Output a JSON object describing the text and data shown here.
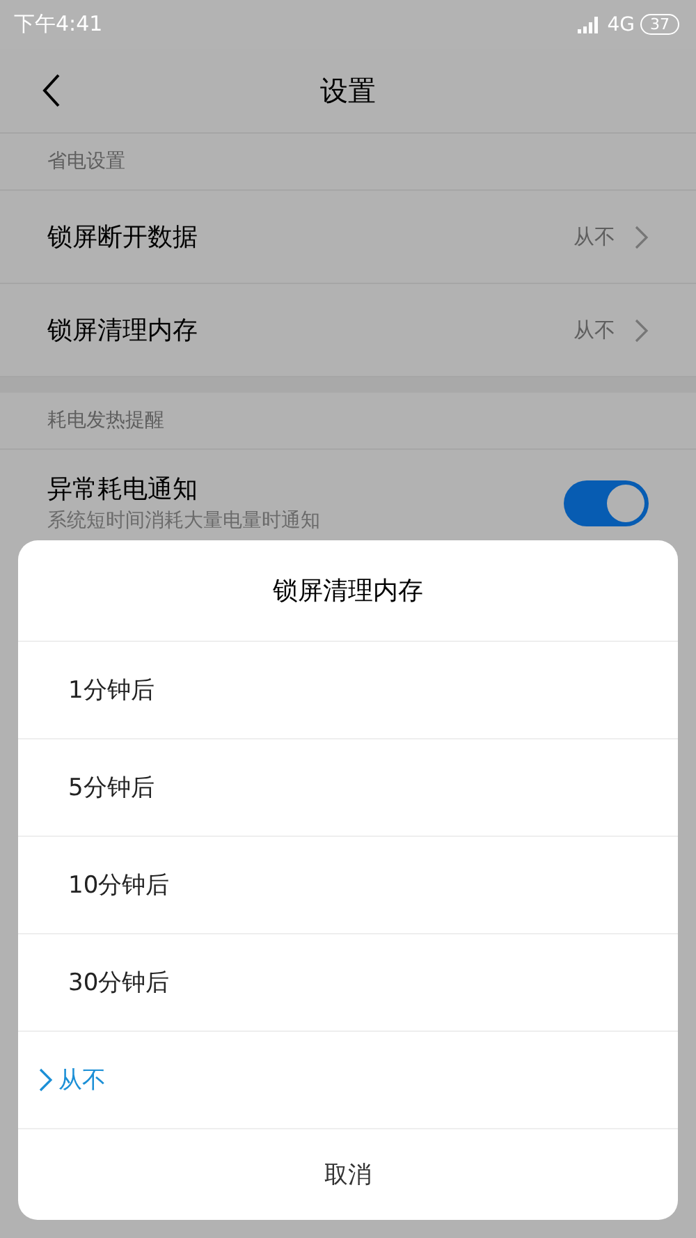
{
  "status_bar": {
    "time": "下午4:41",
    "network": "4G",
    "battery": "37"
  },
  "header": {
    "title": "设置"
  },
  "sections": [
    {
      "title": "省电设置",
      "rows": [
        {
          "kind": "value",
          "label": "锁屏断开数据",
          "value": "从不"
        },
        {
          "kind": "value",
          "label": "锁屏清理内存",
          "value": "从不"
        }
      ]
    },
    {
      "title": "耗电发热提醒",
      "rows": [
        {
          "kind": "toggle",
          "label": "异常耗电通知",
          "subtitle": "系统短时间消耗大量电量时通知",
          "on": true
        }
      ]
    }
  ],
  "dialog": {
    "title": "锁屏清理内存",
    "options": [
      {
        "label": "1分钟后",
        "selected": false
      },
      {
        "label": "5分钟后",
        "selected": false
      },
      {
        "label": "10分钟后",
        "selected": false
      },
      {
        "label": "30分钟后",
        "selected": false
      },
      {
        "label": "从不",
        "selected": true
      }
    ],
    "cancel": "取消"
  }
}
